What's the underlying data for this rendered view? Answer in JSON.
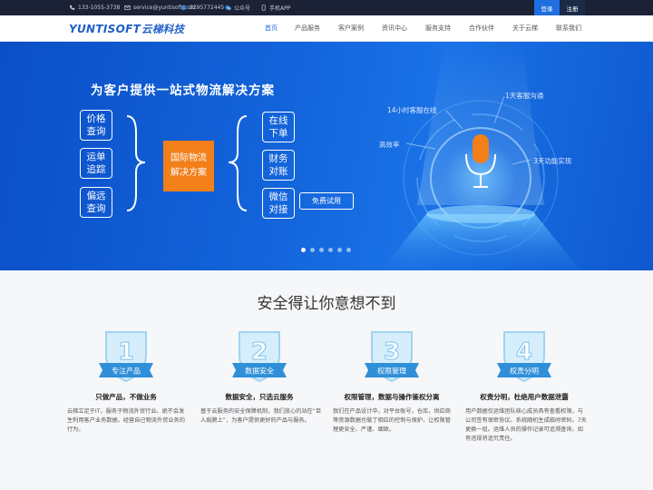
{
  "topbar": {
    "phone": "133-1055-3738",
    "email": "service@yuntisoft.com",
    "qq": "2295772445",
    "wechat": "公众号",
    "mobile": "手机APP",
    "login": "登录",
    "register": "注册"
  },
  "logo": {
    "en": "YUNTISOFT",
    "cn": "云梯科技"
  },
  "nav": [
    "首页",
    "产品服务",
    "客户案例",
    "资讯中心",
    "服务支持",
    "合作伙伴",
    "关于云梯",
    "联系我们"
  ],
  "banner": {
    "title": "为客户提供一站式物流解决方案",
    "left_pills": [
      "价格\n查询",
      "运单\n追踪",
      "偏远\n查询"
    ],
    "center": "国际物流\n解决方案",
    "right_pills": [
      "在线\n下单",
      "财务\n对账",
      "微信\n对接"
    ],
    "trial": "免费试用",
    "labels": [
      "1天客服沟通",
      "14小时客服在线",
      "高效率",
      "3天功能实现"
    ]
  },
  "section": {
    "title": "安全得让你意想不到"
  },
  "features": [
    {
      "num": "1",
      "badge": "专注产品",
      "head": "只做产品，不做业务",
      "desc": "云梯立足于IT，服务于物流外贸行业。绝不会发生利用客户业务数据，经营自己物流外贸业务的行为。"
    },
    {
      "num": "2",
      "badge": "数据安全",
      "head": "数据安全，只选云服务",
      "desc": "基于云服务的安全保障机制，我们放心的站在“巨人肩膀上”，为客户提供更好的产品与服务。"
    },
    {
      "num": "3",
      "badge": "权限管理",
      "head": "权限管理，数据与操作鉴权分离",
      "desc": "我们在产品设计中，对平台账号，仓库，供应商等资源数据也做了相应的控制与保护，让权限管理更安全、严谨、细致。"
    },
    {
      "num": "4",
      "badge": "权责分明",
      "head": "权责分明，杜绝用户数据泄露",
      "desc": "用户数据仅运维团队核心成员具有查看权限，与公司签有保密协议。系统随机生成临时密码，7天更换一组。运维人员的操作记录可追溯查询，如有违规将追究责任。"
    }
  ],
  "colors": {
    "primary": "#1f6fe0",
    "accent": "#f27f1a",
    "topbar": "#1b2235",
    "badge_light": "#bfe3f7",
    "badge_dark": "#2f8fd8"
  }
}
